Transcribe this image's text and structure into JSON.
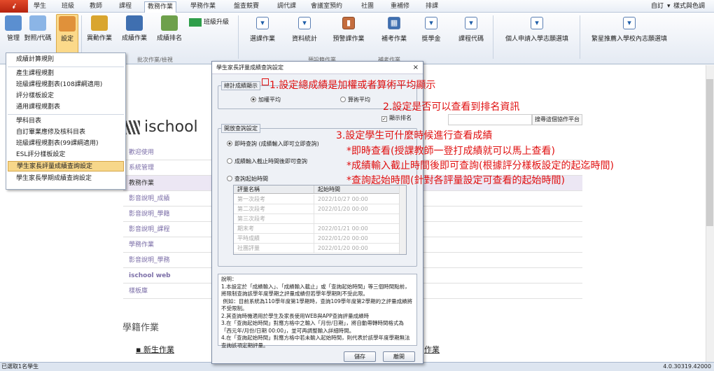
{
  "app_button": "𝒾",
  "tabs": [
    "學生",
    "班級",
    "教師",
    "課程",
    "教務作業",
    "學務作業",
    "盤查競賽",
    "調代課",
    "會議室預約",
    "社團",
    "重補修",
    "排課"
  ],
  "active_tab": "教務作業",
  "top_right": {
    "custom": "自訂",
    "style": "樣式與色調"
  },
  "ribbon": {
    "group1": [
      "管理",
      "對照/代碼",
      "設定"
    ],
    "group2": [
      "異動作業",
      "成績作業",
      "成績排名"
    ],
    "class_promote": "班級升級",
    "group_label": "批次作業/檢視",
    "group_label2": "預設籍作業",
    "group_label3": "補考作業",
    "buttons2": [
      "選課作業",
      "資料統計",
      "預警課作業",
      "補考作業",
      "獎學金",
      "課程代碼",
      "個人申請入學志願選填",
      "繁星推薦入學校內志願選填"
    ]
  },
  "menu": [
    "成績計算規則",
    "產生課程規劃",
    "班級課程規劃表(108課綱適用)",
    "評分樣板設定",
    "通用課程規劃表",
    "學科目表",
    "自訂畢業應修及核科目表",
    "班級課程規劃表(99課綱適用)",
    "ESL評分樣板設定",
    "學生家長評量成績查詢設定",
    "學生家長學期成績查詢設定"
  ],
  "menu_selected": 9,
  "page": {
    "logo": "ischool",
    "search_btn": "搜尋這個協作平台",
    "nav": [
      "歡迎使用",
      "系統管理",
      "教務作業",
      "影音說明_成績",
      "影音說明_學籍",
      "影音說明_課程",
      "學務作業",
      "影音說明_學務",
      "ischool web",
      "樣板庫"
    ],
    "section": "學籍作業",
    "bullet": "新生作業",
    "right_frag": "作業"
  },
  "dialog": {
    "title": "學生家長評量成績查詢設定",
    "close": "×",
    "fs1_legend": "總計成績顯示",
    "opt_weighted": "加權平均",
    "opt_arith": "算術平均",
    "show_rank": "顯示排名",
    "fs2_legend": "開放查詢設定",
    "opt_now": "即時查詢 (成績輸入即可立即查詢)",
    "opt_after": "成績輸入截止時間後即可查詢",
    "opt_start": "查詢起始時間",
    "col_name": "評量名稱",
    "col_time": "起始時間",
    "rows": [
      [
        "第一次段考",
        "2022/10/27 00:00"
      ],
      [
        "第二次段考",
        "2022/01/20 00:00"
      ],
      [
        "第三次段考",
        ""
      ],
      [
        "期末考",
        "2022/01/21 00:00"
      ],
      [
        "平時成績",
        "2022/01/20 00:00"
      ],
      [
        "社團評量",
        "2022/01/20 00:00"
      ]
    ],
    "note": "說明：\n1.本設定於「成績輸入」、「成績輸入截止」或「查詢起始時間」等三個時間點前，將限制查詢該學年度學期之評量成績但若學年學期則不受此限。\n 例如：目前系統為110學年度第1學期時，查詢109學年度第2學期的之評量成績將不受限制。\n2.其查詢時機適用於學生及家長使用WEB與APP查詢評量成績時\n3.在「查詢起始時間」對應方格中之輸入「月份/日期」，將自動帶轉時間格式為「西元年/月份/日期 00:00」，並可再調整輸入詳細時間。\n4.在「查詢起始時間」對應方格中若未輸入起始時間，則代表於該學年度學期無法查詢該項定期評量。",
    "save": "儲存",
    "cancel": "離開"
  },
  "annotations": [
    "1.設定總成績是加權或者算術平均顯示",
    "2.設定是否可以查看到排名資訊",
    "3.設定學生可什麼時候進行查看成績",
    "*即時查看(授課教師一登打成績就可以馬上查看)",
    "*成績輸入截止時間後即可查詢(根據評分樣板設定的起迄時間)",
    "*查詢起始時間(針對各評量設定可查看的起始時間)"
  ],
  "status": {
    "left": "已選取1名學生",
    "right": "4.0.30319.42000"
  },
  "colors": {
    "annotation": "#e01010",
    "menu_highlight": "#f7d78a",
    "nav_active": "#ece7f4"
  }
}
